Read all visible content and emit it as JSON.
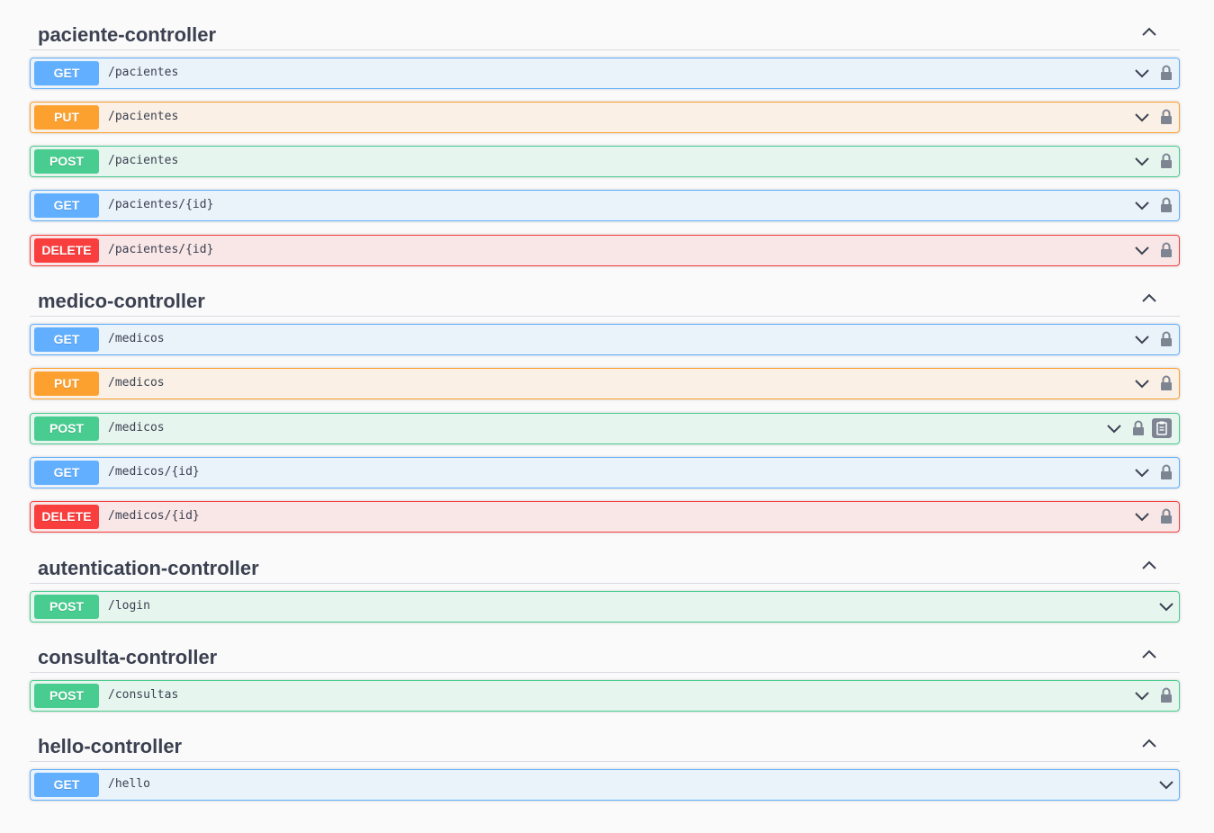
{
  "colors": {
    "get": "#61affe",
    "put": "#fca130",
    "post": "#49cc90",
    "delete": "#f93e3e",
    "text": "#3b4151"
  },
  "icons": {
    "expand": "chevron-down-icon",
    "collapse": "chevron-up-icon",
    "authorize": "lock-icon",
    "copy": "copy-to-clipboard-icon"
  },
  "sections": [
    {
      "title": "paciente-controller",
      "operations": [
        {
          "method": "GET",
          "path": "/pacientes"
        },
        {
          "method": "PUT",
          "path": "/pacientes"
        },
        {
          "method": "POST",
          "path": "/pacientes"
        },
        {
          "method": "GET",
          "path": "/pacientes/{id}"
        },
        {
          "method": "DELETE",
          "path": "/pacientes/{id}"
        }
      ]
    },
    {
      "title": "medico-controller",
      "operations": [
        {
          "method": "GET",
          "path": "/medicos"
        },
        {
          "method": "PUT",
          "path": "/medicos"
        },
        {
          "method": "POST",
          "path": "/medicos"
        },
        {
          "method": "GET",
          "path": "/medicos/{id}"
        },
        {
          "method": "DELETE",
          "path": "/medicos/{id}"
        }
      ]
    },
    {
      "title": "autentication-controller",
      "operations": [
        {
          "method": "POST",
          "path": "/login"
        }
      ]
    },
    {
      "title": "consulta-controller",
      "operations": [
        {
          "method": "POST",
          "path": "/consultas"
        }
      ]
    },
    {
      "title": "hello-controller",
      "operations": [
        {
          "method": "GET",
          "path": "/hello"
        }
      ]
    }
  ]
}
